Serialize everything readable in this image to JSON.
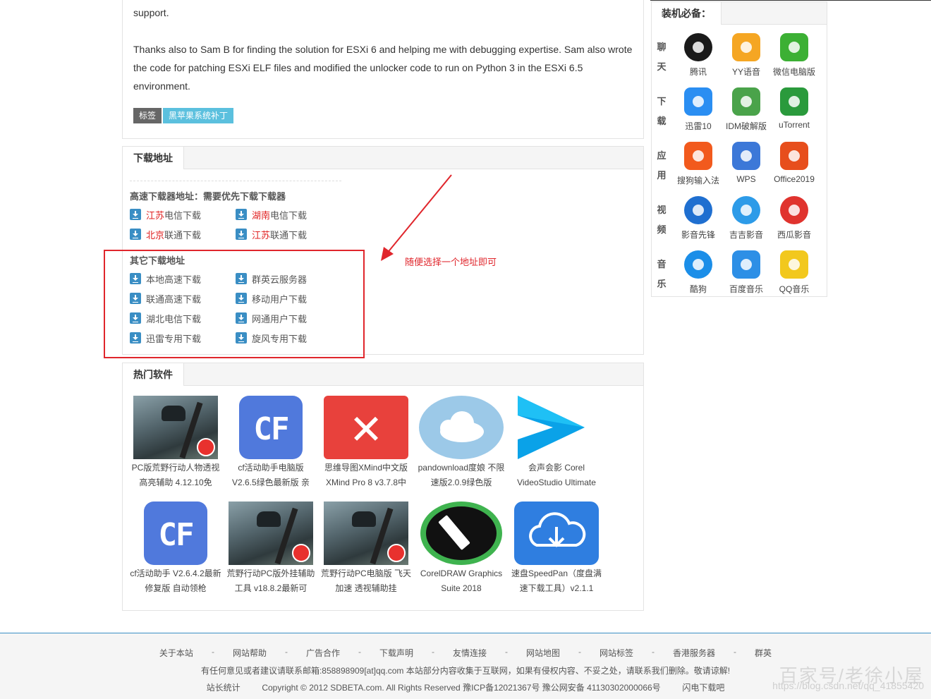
{
  "article": {
    "line1": "support.",
    "para": "Thanks also to Sam B for finding the solution for ESXi 6 and helping me with debugging expertise. Sam also wrote the code for patching ESXi ELF files and modified the unlocker code to run on Python 3 in the ESXi 6.5 environment.",
    "tag_label": "标签",
    "tag": "黑苹果系统补丁"
  },
  "download": {
    "title": "下载地址",
    "high_speed_heading": "高速下载器地址：需要优先下载下载器",
    "high_speed": [
      {
        "prefix": "江苏",
        "suffix": "电信下载"
      },
      {
        "prefix": "湖南",
        "suffix": "电信下载"
      },
      {
        "prefix": "北京",
        "suffix": "联通下载"
      },
      {
        "prefix": "江苏",
        "suffix": "联通下载"
      }
    ],
    "other_heading": "其它下载地址",
    "other": [
      "本地高速下载",
      "群英云服务器",
      "联通高速下载",
      "移动用户下载",
      "湖北电信下载",
      "网通用户下载",
      "迅雷专用下载",
      "旋风专用下载"
    ]
  },
  "annotation": {
    "text": "随便选择一个地址即可",
    "color": "#e0262c"
  },
  "hot": {
    "title": "热门软件",
    "items": [
      {
        "name": "PC版荒野行动人物透视高亮辅助 4.12.10免",
        "icon": "game-thumb"
      },
      {
        "name": "cf活动助手电脑版 V2.6.5绿色最新版 亲",
        "icon": "cf-thumb",
        "glyph": "CF"
      },
      {
        "name": "思维导图XMind中文版 XMind Pro 8 v3.7.8中",
        "icon": "xmind-thumb",
        "glyph": "✕"
      },
      {
        "name": "pandownload度娘 不限速版2.0.9绿色版",
        "icon": "cloud-thumb"
      },
      {
        "name": "会声会影 Corel VideoStudio Ultimate",
        "icon": "videostudio-thumb"
      },
      {
        "name": "cf活动助手 V2.6.4.2最新修复版 自动领枪",
        "icon": "cf-thumb",
        "glyph": "CF"
      },
      {
        "name": "荒野行动PC版外挂辅助工具 v18.8.2最新可",
        "icon": "game-thumb"
      },
      {
        "name": "荒野行动PC电脑版 飞天 加速 透视辅助挂",
        "icon": "game-thumb"
      },
      {
        "name": "CorelDRAW Graphics Suite 2018",
        "icon": "coreldraw-thumb"
      },
      {
        "name": "速盘SpeedPan（度盘满速下载工具）v2.1.1",
        "icon": "speedpan-thumb"
      }
    ]
  },
  "sidebar": {
    "title": "装机必备：",
    "categories": [
      {
        "label": "聊天",
        "apps": [
          {
            "name": "腾讯",
            "icon": "qq-icon",
            "color": "#1a1a1a"
          },
          {
            "name": "YY语音",
            "icon": "yy-icon",
            "color": "#f5a623"
          },
          {
            "name": "微信电脑版",
            "icon": "wechat-icon",
            "color": "#3cb034"
          }
        ]
      },
      {
        "label": "下载",
        "apps": [
          {
            "name": "迅雷10",
            "icon": "thunder-icon",
            "color": "#2a8ef2"
          },
          {
            "name": "IDM破解版",
            "icon": "idm-icon",
            "color": "#4aa34a"
          },
          {
            "name": "uTorrent",
            "icon": "utorrent-icon",
            "color": "#2a9a3c"
          }
        ]
      },
      {
        "label": "应用",
        "apps": [
          {
            "name": "搜狗输入法",
            "icon": "sogou-icon",
            "color": "#f25a1d"
          },
          {
            "name": "WPS",
            "icon": "wps-icon",
            "color": "#3c78d8"
          },
          {
            "name": "Office2019",
            "icon": "office-icon",
            "color": "#e74e1c"
          }
        ]
      },
      {
        "label": "视频",
        "apps": [
          {
            "name": "影音先锋",
            "icon": "xfplay-icon",
            "color": "#1f6fd0"
          },
          {
            "name": "吉吉影音",
            "icon": "jjvod-icon",
            "color": "#2d9be8"
          },
          {
            "name": "西瓜影音",
            "icon": "xigua-icon",
            "color": "#e0332e"
          }
        ]
      },
      {
        "label": "音乐",
        "apps": [
          {
            "name": "酷狗",
            "icon": "kugou-icon",
            "color": "#1b8ee8"
          },
          {
            "name": "百度音乐",
            "icon": "baidu-music-icon",
            "color": "#2d8fe6"
          },
          {
            "name": "QQ音乐",
            "icon": "qqmusic-icon",
            "color": "#f2c81d"
          }
        ]
      }
    ]
  },
  "footer": {
    "links": [
      "关于本站",
      "网站帮助",
      "广告合作",
      "下载声明",
      "友情连接",
      "网站地图",
      "网站标签",
      "香港服务器",
      "群英"
    ],
    "separator": "-",
    "notice": "有任何意见或者建议请联系邮箱:858898909[at]qq.com 本站部分内容收集于互联网，如果有侵权内容、不妥之处，请联系我们删除。敬请谅解!",
    "stats": "站长统计",
    "copyright": "Copyright © 2012 SDBETA.com. All Rights Reserved 豫ICP备12021367号 豫公网安备 41130302000066号",
    "brand": "闪电下载吧",
    "watermark": "百家号/老徐小屋",
    "watermark_url": "https://blog.csdn.net/qq_41855420"
  }
}
